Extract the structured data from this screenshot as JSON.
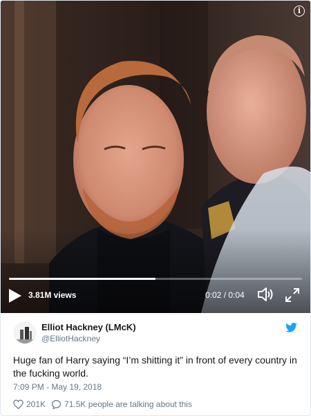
{
  "video": {
    "views": "3.81M views",
    "time": "0:02 / 0:04",
    "progress": 0.5
  },
  "tweet": {
    "display_name": "Elliot Hackney (LMcK)",
    "handle": "@ElliotHackney",
    "text": "Huge fan of Harry saying “I’m shitting it” in front of every country in the fucking world.",
    "timestamp": "7:09 PM - May 19, 2018",
    "likes": "201K",
    "talking": "71.5K people are talking about this"
  },
  "colors": {
    "twitter_blue": "#1da1f2",
    "text": "#14171a",
    "secondary": "#657786"
  },
  "icons": [
    "info-icon",
    "play-icon",
    "volume-icon",
    "fullscreen-icon",
    "twitter-bird-icon",
    "heart-icon",
    "speech-bubble-icon"
  ]
}
